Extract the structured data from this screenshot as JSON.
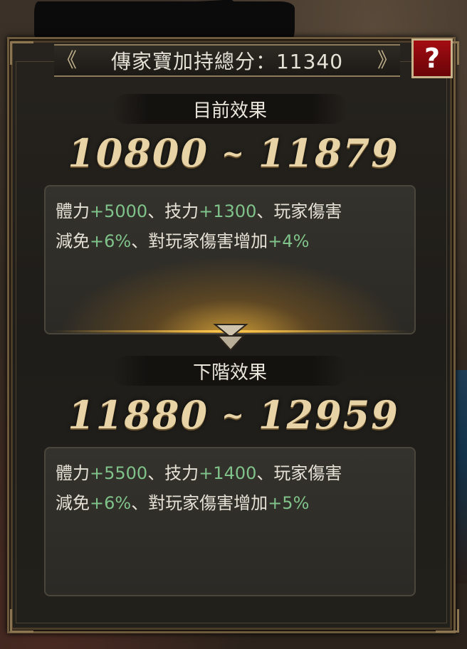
{
  "title": {
    "label": "傳家寶加持總分：11340",
    "chevron_left": "《",
    "chevron_right": "》"
  },
  "help_button": {
    "label": "?",
    "icon": "question-icon"
  },
  "current": {
    "section_label": "目前效果",
    "range_min": "10800",
    "range_sep": "~",
    "range_max": "11879",
    "line1": [
      {
        "text": "體力",
        "kind": "text"
      },
      {
        "text": "+5000",
        "kind": "plus"
      },
      {
        "text": "、技力",
        "kind": "text"
      },
      {
        "text": "+1300",
        "kind": "plus"
      },
      {
        "text": "、玩家傷害",
        "kind": "text"
      }
    ],
    "line2": [
      {
        "text": "減免",
        "kind": "text"
      },
      {
        "text": "+6%",
        "kind": "plus"
      },
      {
        "text": "、對玩家傷害增加",
        "kind": "text"
      },
      {
        "text": "+4%",
        "kind": "plus"
      }
    ]
  },
  "next": {
    "section_label": "下階效果",
    "range_min": "11880",
    "range_sep": "~",
    "range_max": "12959",
    "line1": [
      {
        "text": "體力",
        "kind": "text"
      },
      {
        "text": "+5500",
        "kind": "plus"
      },
      {
        "text": "、技力",
        "kind": "text"
      },
      {
        "text": "+1400",
        "kind": "plus"
      },
      {
        "text": "、玩家傷害",
        "kind": "text"
      }
    ],
    "line2": [
      {
        "text": "減免",
        "kind": "text"
      },
      {
        "text": "+6%",
        "kind": "plus"
      },
      {
        "text": "、對玩家傷害增加",
        "kind": "text"
      },
      {
        "text": "+5%",
        "kind": "plus"
      }
    ]
  },
  "icons": {
    "arrow": "double-chevron-down-icon"
  },
  "colors": {
    "plus_value": "#7fc38a",
    "range_gold": "#e7d3a6",
    "help_red": "#a30d12",
    "frame_gold": "#8d7a58"
  }
}
